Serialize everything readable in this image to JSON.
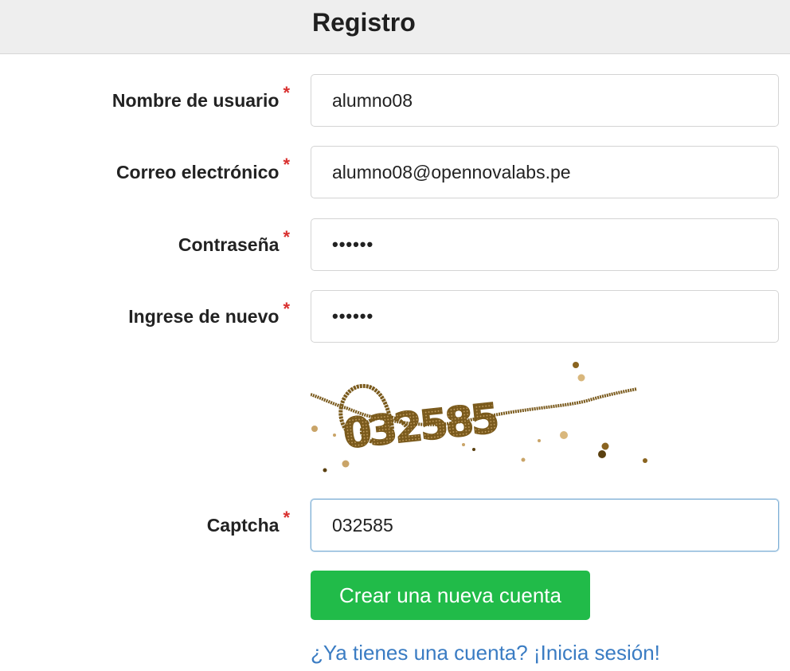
{
  "header": {
    "title": "Registro"
  },
  "form": {
    "required_marker": "*",
    "username": {
      "label": "Nombre de usuario",
      "value": "alumno08"
    },
    "email": {
      "label": "Correo electrónico",
      "value": "alumno08@opennovalabs.pe"
    },
    "password": {
      "label": "Contraseña",
      "value": "••••••"
    },
    "password_confirm": {
      "label": "Ingrese de nuevo",
      "value": "••••••"
    },
    "captcha": {
      "label": "Captcha",
      "value": "032585",
      "image_text": "032585"
    },
    "submit_label": "Crear una nueva cuenta",
    "login_link": "¿Ya tienes una cuenta? ¡Inicia sesión!"
  },
  "colors": {
    "header_bg": "#eeeeee",
    "required_star": "#d9302f",
    "submit_bg": "#21bb49",
    "link": "#3a7cc3",
    "captcha_ink": "#7a5a1c"
  }
}
